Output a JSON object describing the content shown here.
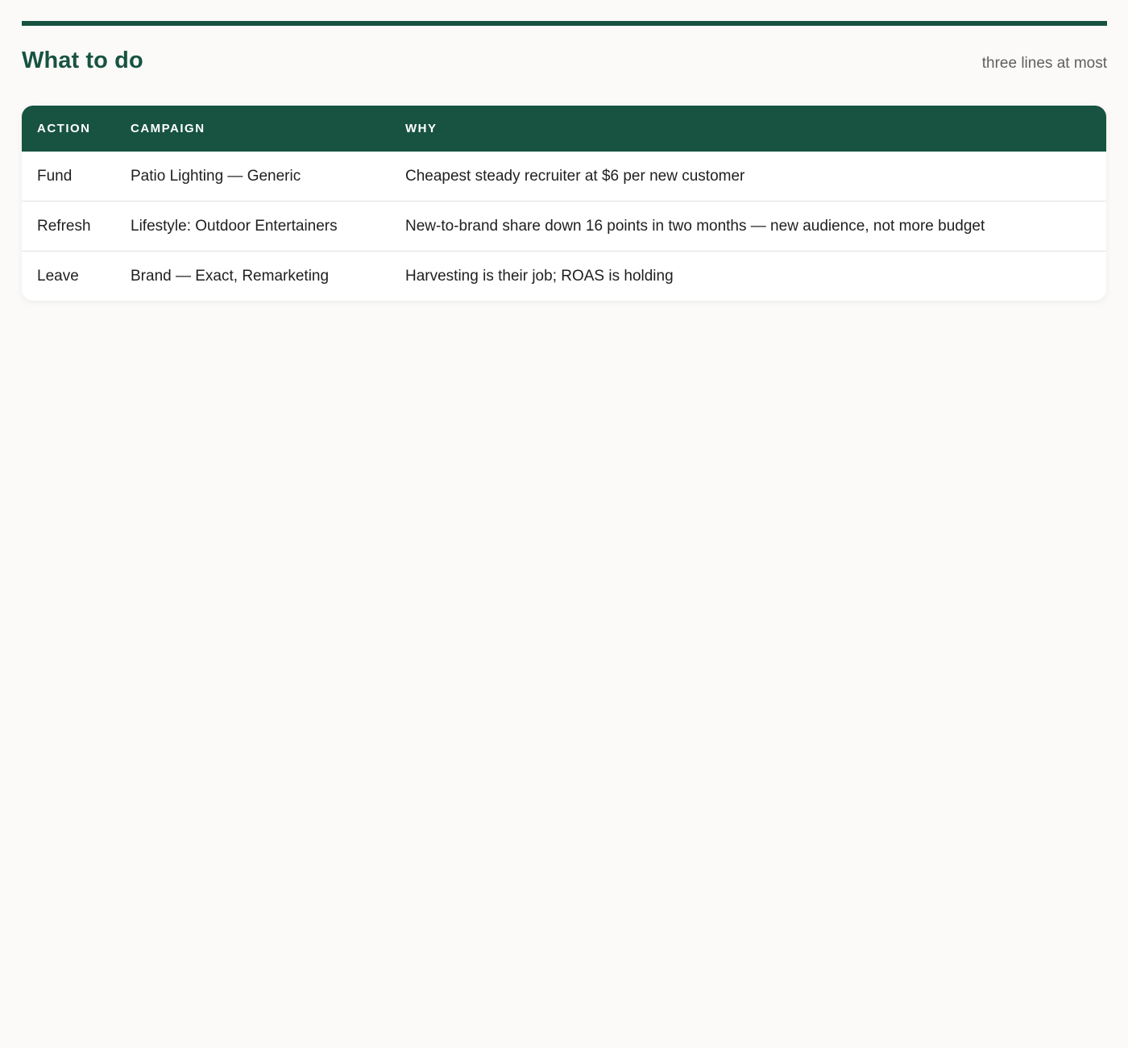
{
  "header": {
    "title": "What to do",
    "subtitle": "three lines at most"
  },
  "table": {
    "columns": [
      "ACTION",
      "CAMPAIGN",
      "WHY"
    ],
    "rows": [
      {
        "action": "Fund",
        "campaign": "Patio Lighting — Generic",
        "why": "Cheapest steady recruiter at $6 per new customer"
      },
      {
        "action": "Refresh",
        "campaign": "Lifestyle: Outdoor Entertainers",
        "why": "New-to-brand share down 16 points in two months — new audience, not more budget"
      },
      {
        "action": "Leave",
        "campaign": "Brand — Exact, Remarketing",
        "why": "Harvesting is their job; ROAS is holding"
      }
    ]
  },
  "colors": {
    "accent": "#185342",
    "background": "#fbfaf8"
  }
}
